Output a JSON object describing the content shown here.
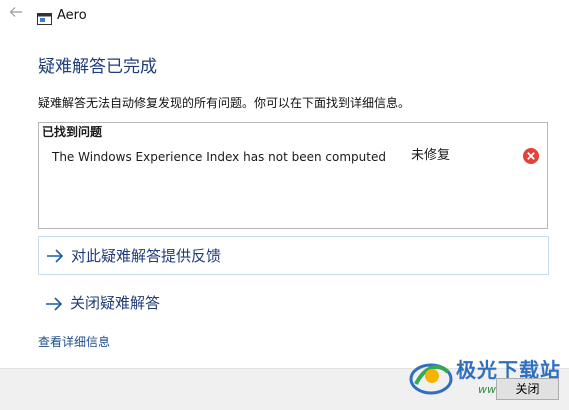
{
  "window": {
    "title": "Aero",
    "back_icon": "back-arrow-icon",
    "app_icon": "troubleshooter-window-icon"
  },
  "main": {
    "heading": "疑难解答已完成",
    "description": "疑难解答无法自动修复发现的所有问题。你可以在下面找到详细信息。",
    "problems": {
      "title": "已找到问题",
      "items": [
        {
          "name": "The Windows Experience Index has not been computed",
          "status": "未修复",
          "status_icon": "error-x-icon"
        }
      ]
    },
    "links": {
      "feedback": "对此疑难解答提供反馈",
      "close_troubleshooter": "关闭疑难解答"
    },
    "details_link": "查看详细信息"
  },
  "footer": {
    "close_button": "关闭"
  },
  "watermark": {
    "text": "极光下载站",
    "url": "www.xz7.com"
  },
  "colors": {
    "heading": "#1f3d7a",
    "link": "#1e4e8c",
    "error": "#e5423a",
    "footer_bg": "#f0f0f0"
  }
}
